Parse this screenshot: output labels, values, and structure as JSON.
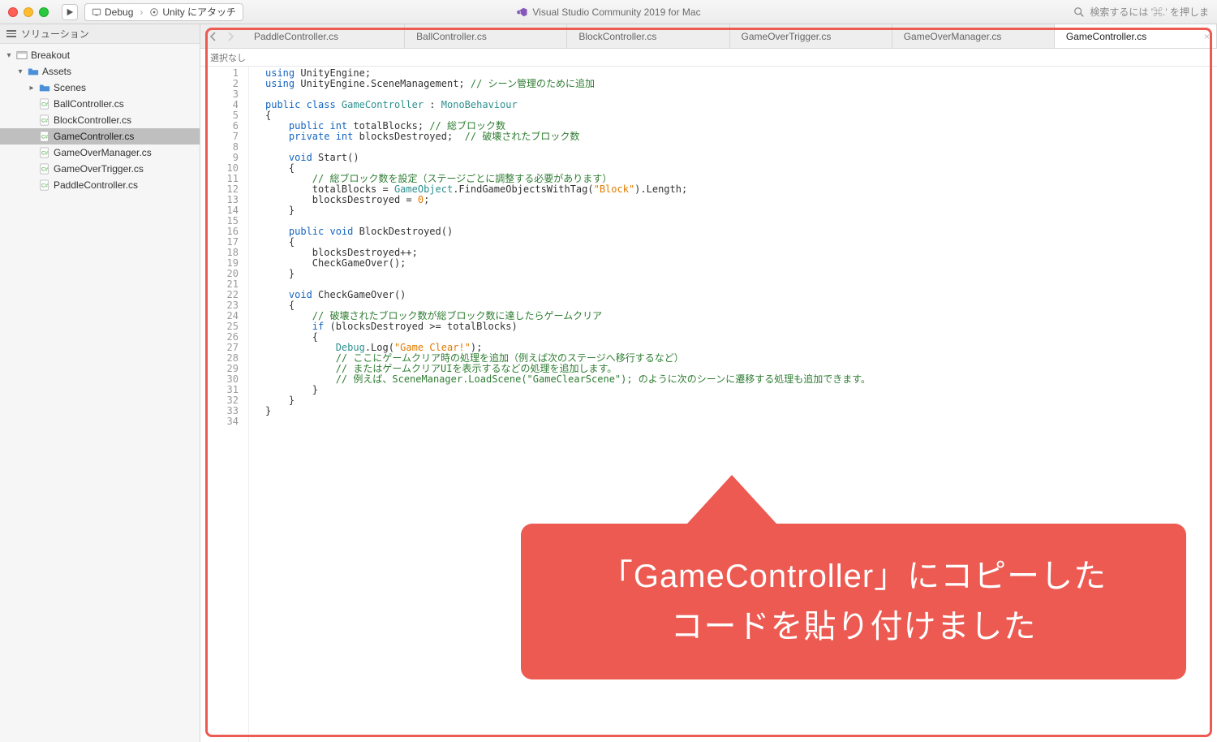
{
  "toolbar": {
    "debug_config": "Debug",
    "attach_target": "Unity にアタッチ",
    "window_title": "Visual Studio Community 2019 for Mac",
    "search_placeholder": "検索するには '⌘.' を押しま"
  },
  "sidebar": {
    "pane_title": "ソリューション",
    "root": "Breakout",
    "assets": "Assets",
    "scenes_folder": "Scenes",
    "files": [
      "BallController.cs",
      "BlockController.cs",
      "GameController.cs",
      "GameOverManager.cs",
      "GameOverTrigger.cs",
      "PaddleController.cs"
    ],
    "selected": "GameController.cs"
  },
  "tabs": {
    "items": [
      "PaddleController.cs",
      "BallController.cs",
      "BlockController.cs",
      "GameOverTrigger.cs",
      "GameOverManager.cs",
      "GameController.cs"
    ],
    "active_index": 5
  },
  "editor": {
    "breadcrumb": "選択なし",
    "line_count": 34,
    "code_lines": [
      [
        [
          "kw",
          "using"
        ],
        [
          "",
          " UnityEngine;"
        ]
      ],
      [
        [
          "kw",
          "using"
        ],
        [
          "",
          " UnityEngine.SceneManagement; "
        ],
        [
          "cmt",
          "// シーン管理のために追加"
        ]
      ],
      [
        [
          "",
          ""
        ]
      ],
      [
        [
          "kw",
          "public class "
        ],
        [
          "type",
          "GameController"
        ],
        [
          "",
          " : "
        ],
        [
          "type",
          "MonoBehaviour"
        ]
      ],
      [
        [
          "",
          "{"
        ]
      ],
      [
        [
          "",
          "    "
        ],
        [
          "kw",
          "public int"
        ],
        [
          "",
          " totalBlocks; "
        ],
        [
          "cmt",
          "// 総ブロック数"
        ]
      ],
      [
        [
          "",
          "    "
        ],
        [
          "kw",
          "private int"
        ],
        [
          "",
          " blocksDestroyed;  "
        ],
        [
          "cmt",
          "// 破壊されたブロック数"
        ]
      ],
      [
        [
          "",
          ""
        ]
      ],
      [
        [
          "",
          "    "
        ],
        [
          "kw",
          "void"
        ],
        [
          "",
          " Start()"
        ]
      ],
      [
        [
          "",
          "    {"
        ]
      ],
      [
        [
          "",
          "        "
        ],
        [
          "cmt",
          "// 総ブロック数を設定（ステージごとに調整する必要があります）"
        ]
      ],
      [
        [
          "",
          "        totalBlocks = "
        ],
        [
          "type",
          "GameObject"
        ],
        [
          "",
          ".FindGameObjectsWithTag("
        ],
        [
          "str",
          "\"Block\""
        ],
        [
          "",
          ").Length;"
        ]
      ],
      [
        [
          "",
          "        blocksDestroyed = "
        ],
        [
          "num",
          "0"
        ],
        [
          "",
          ";"
        ]
      ],
      [
        [
          "",
          "    }"
        ]
      ],
      [
        [
          "",
          ""
        ]
      ],
      [
        [
          "",
          "    "
        ],
        [
          "kw",
          "public void"
        ],
        [
          "",
          " BlockDestroyed()"
        ]
      ],
      [
        [
          "",
          "    {"
        ]
      ],
      [
        [
          "",
          "        blocksDestroyed++;"
        ]
      ],
      [
        [
          "",
          "        CheckGameOver();"
        ]
      ],
      [
        [
          "",
          "    }"
        ]
      ],
      [
        [
          "",
          ""
        ]
      ],
      [
        [
          "",
          "    "
        ],
        [
          "kw",
          "void"
        ],
        [
          "",
          " CheckGameOver()"
        ]
      ],
      [
        [
          "",
          "    {"
        ]
      ],
      [
        [
          "",
          "        "
        ],
        [
          "cmt",
          "// 破壊されたブロック数が総ブロック数に達したらゲームクリア"
        ]
      ],
      [
        [
          "",
          "        "
        ],
        [
          "kw",
          "if"
        ],
        [
          "",
          " (blocksDestroyed >= totalBlocks)"
        ]
      ],
      [
        [
          "",
          "        {"
        ]
      ],
      [
        [
          "",
          "            "
        ],
        [
          "type",
          "Debug"
        ],
        [
          "",
          ".Log("
        ],
        [
          "str",
          "\"Game Clear!\""
        ],
        [
          "",
          ");"
        ]
      ],
      [
        [
          "",
          "            "
        ],
        [
          "cmt",
          "// ここにゲームクリア時の処理を追加（例えば次のステージへ移行するなど）"
        ]
      ],
      [
        [
          "",
          "            "
        ],
        [
          "cmt",
          "// またはゲームクリアUIを表示するなどの処理を追加します。"
        ]
      ],
      [
        [
          "",
          "            "
        ],
        [
          "cmt",
          "// 例えば、SceneManager.LoadScene(\"GameClearScene\"); のように次のシーンに遷移する処理も追加できます。"
        ]
      ],
      [
        [
          "",
          "        }"
        ]
      ],
      [
        [
          "",
          "    }"
        ]
      ],
      [
        [
          "",
          "}"
        ]
      ],
      [
        [
          "",
          ""
        ]
      ]
    ]
  },
  "annotation": {
    "line1": "「GameController」にコピーした",
    "line2": "コードを貼り付けました"
  }
}
